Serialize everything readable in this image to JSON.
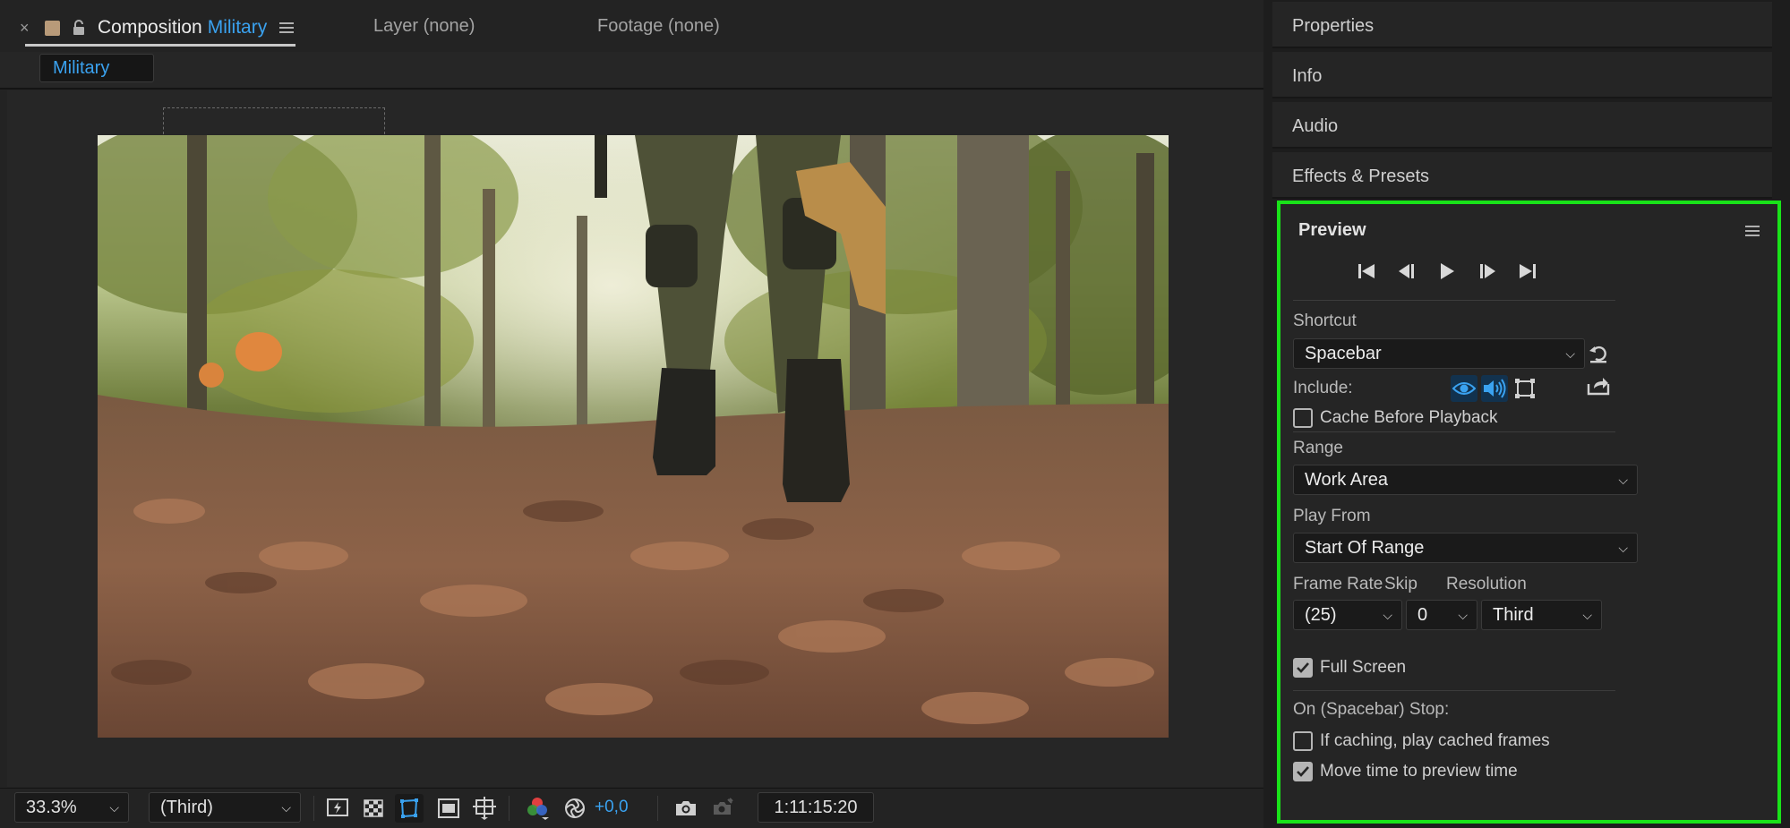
{
  "composition_panel": {
    "tabs": {
      "active": {
        "prefix": "Composition",
        "name": "Military"
      },
      "layer": "Layer (none)",
      "footage": "Footage (none)"
    },
    "comp_subtab": "Military",
    "bottom_bar": {
      "zoom": "33.3%",
      "resolution": "(Third)",
      "exposure": "+0,0",
      "timecode": "1:11:15:20"
    }
  },
  "right_panel": {
    "collapsed_panels": [
      "Properties",
      "Info",
      "Audio",
      "Effects & Presets"
    ],
    "preview": {
      "title": "Preview",
      "shortcut_label": "Shortcut",
      "shortcut_value": "Spacebar",
      "include_label": "Include:",
      "cache_before_playback": {
        "label": "Cache Before Playback",
        "checked": false
      },
      "range_label": "Range",
      "range_value": "Work Area",
      "play_from_label": "Play From",
      "play_from_value": "Start Of Range",
      "frame_rate_label": "Frame Rate",
      "frame_rate_value": "(25)",
      "skip_label": "Skip",
      "skip_value": "0",
      "resolution_label": "Resolution",
      "resolution_value": "Third",
      "full_screen": {
        "label": "Full Screen",
        "checked": true
      },
      "on_stop_label": "On (Spacebar) Stop:",
      "if_caching": {
        "label": "If caching, play cached frames",
        "checked": false
      },
      "move_time": {
        "label": "Move time to preview time",
        "checked": true
      }
    }
  },
  "colors": {
    "accent": "#3aa2f0",
    "highlight_outline": "#19e219",
    "panel_bg": "#252525"
  }
}
